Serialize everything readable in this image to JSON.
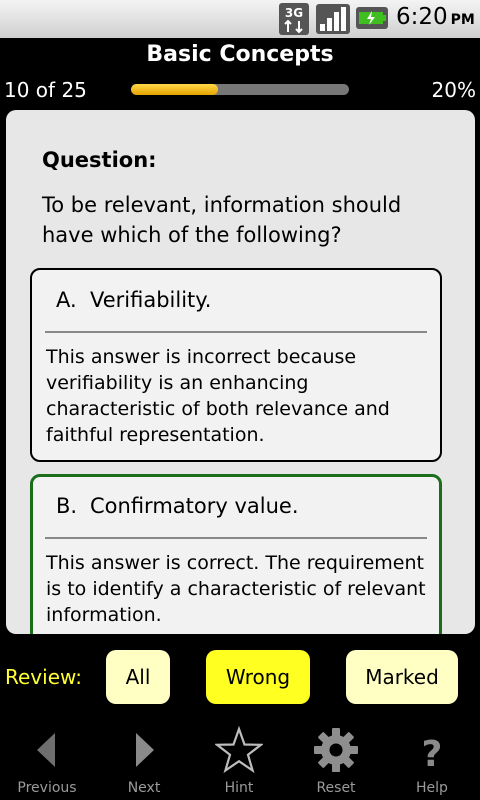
{
  "status_bar": {
    "network": "3G",
    "time": "6:20",
    "ampm": "PM"
  },
  "header": {
    "title": "Basic Concepts"
  },
  "progress": {
    "counter": "10 of 25",
    "percent_label": "20%",
    "fill_fraction": 0.4
  },
  "question": {
    "label": "Question:",
    "text": "To be relevant, information should have which of the following?"
  },
  "answers": [
    {
      "letter": "A.",
      "text": "Verifiability.",
      "explanation": "This answer is incorrect because verifiability is an enhancing characteristic of both relevance and faithful representation."
    },
    {
      "letter": "B.",
      "text": "Confirmatory value.",
      "explanation": "This answer is correct. The requirement is to identify a characteristic of relevant information."
    }
  ],
  "review": {
    "label": "Review:",
    "buttons": [
      "All",
      "Wrong",
      "Marked"
    ],
    "selected": "Wrong"
  },
  "nav": [
    {
      "label": "Previous",
      "icon": "arrow-left-icon"
    },
    {
      "label": "Next",
      "icon": "arrow-right-icon"
    },
    {
      "label": "Hint",
      "icon": "star-icon"
    },
    {
      "label": "Reset",
      "icon": "gear-icon"
    },
    {
      "label": "Help",
      "icon": "question-icon"
    }
  ],
  "colors": {
    "accent_yellow": "#ffff22",
    "correct_green": "#1a6d1a",
    "progress": "#f0b400"
  }
}
